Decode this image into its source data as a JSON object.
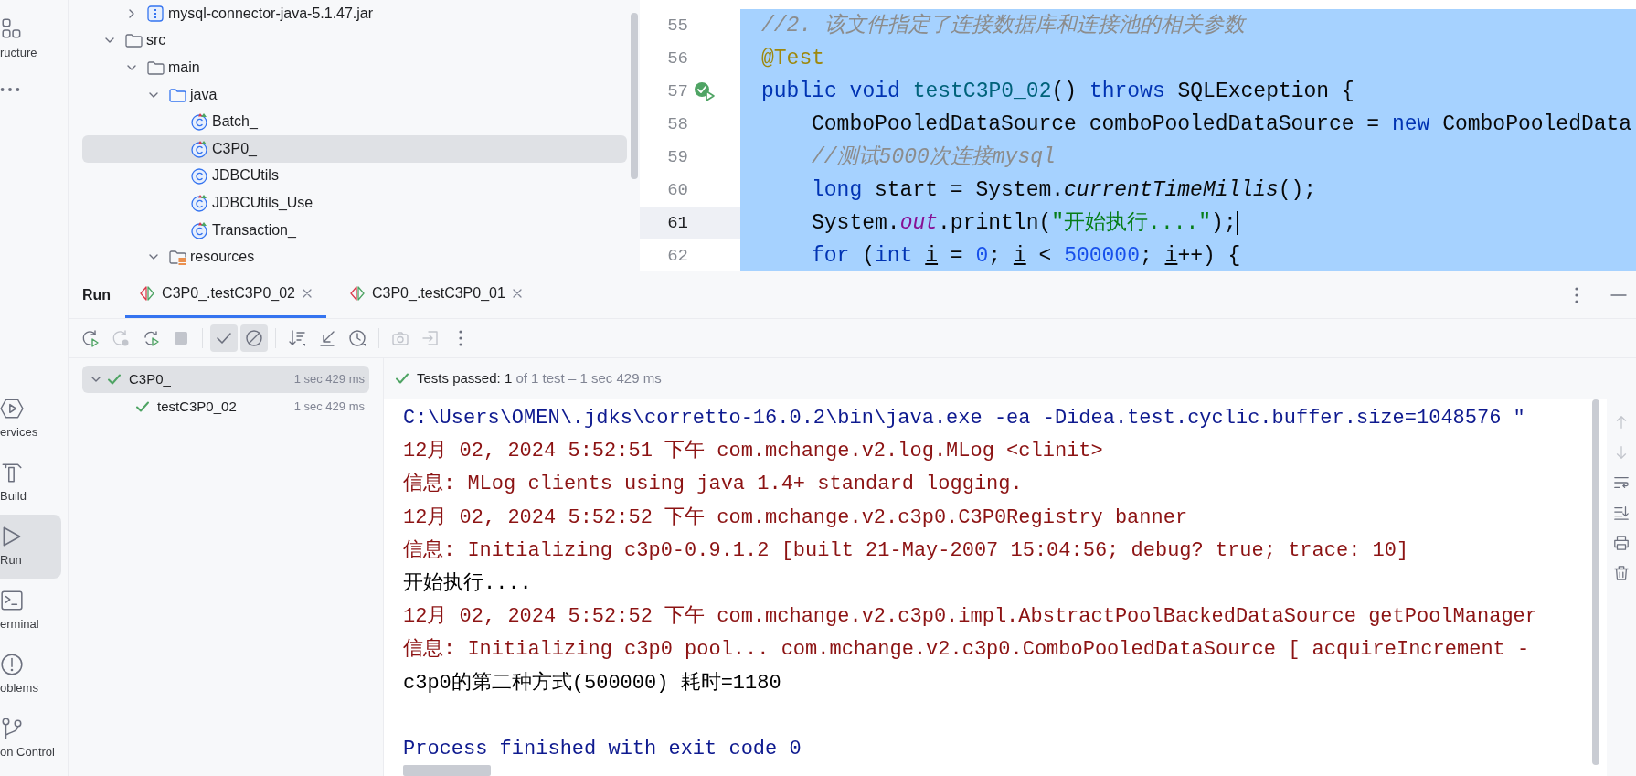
{
  "tool_strip": [
    {
      "kind": "structure",
      "label": "ructure",
      "selected": false
    },
    {
      "kind": "more",
      "selected": false
    },
    {
      "kind": "services",
      "label": "ervices",
      "selected": false
    },
    {
      "kind": "build",
      "label": "Build",
      "selected": false
    },
    {
      "kind": "run",
      "label": "Run",
      "selected": true
    },
    {
      "kind": "terminal",
      "label": "erminal",
      "selected": false
    },
    {
      "kind": "problems",
      "label": "oblems",
      "selected": false
    },
    {
      "kind": "vcs",
      "label": "on Control",
      "selected": false
    }
  ],
  "project_tree": {
    "partial_parent_children": [
      {
        "label": "mysql-connector-java-5.1.47.jar",
        "kind": "jar",
        "expanded": false,
        "selected": false
      }
    ],
    "items": [
      {
        "label": "src",
        "kind": "folder",
        "expanded": true,
        "selected": false,
        "children": [
          {
            "label": "main",
            "kind": "folder",
            "expanded": true,
            "selected": false,
            "children": [
              {
                "label": "java",
                "kind": "source_root",
                "expanded": true,
                "selected": false,
                "children": [
                  {
                    "label": "Batch_",
                    "kind": "test_class",
                    "selected": false
                  },
                  {
                    "label": "C3P0_",
                    "kind": "test_class",
                    "selected": true
                  },
                  {
                    "label": "JDBCUtils",
                    "kind": "class",
                    "selected": false
                  },
                  {
                    "label": "JDBCUtils_Use",
                    "kind": "test_class",
                    "selected": false
                  },
                  {
                    "label": "Transaction_",
                    "kind": "test_class",
                    "selected": false
                  }
                ]
              },
              {
                "label": "resources",
                "kind": "resources_root",
                "expanded": true,
                "selected": false
              }
            ]
          }
        ]
      }
    ]
  },
  "editor": {
    "lines": [
      {
        "number": "55",
        "current": false,
        "selected": true,
        "tokens": [
          {
            "kind": "comment",
            "text": "//2. 该文件指定了连接数据库和连接池的相关参数"
          }
        ]
      },
      {
        "number": "56",
        "current": false,
        "selected": true,
        "tokens": [
          {
            "kind": "annotation",
            "text": "@Test"
          }
        ]
      },
      {
        "number": "57",
        "current": false,
        "selected": true,
        "run_marker": true,
        "tokens": [
          {
            "kind": "keyword",
            "text": "public void "
          },
          {
            "kind": "declaration",
            "text": "testC3P0_02"
          },
          {
            "kind": "plain",
            "text": "() "
          },
          {
            "kind": "keyword",
            "text": "throws "
          },
          {
            "kind": "plain",
            "text": "SQLException {"
          }
        ],
        "children": [
          {
            "number": "58",
            "current": false,
            "selected": true,
            "tokens": [
              {
                "kind": "plain",
                "text": "ComboPooledDataSource comboPooledDataSource = "
              },
              {
                "kind": "keyword",
                "text": "new "
              },
              {
                "kind": "plain",
                "text": "ComboPooledData"
              }
            ]
          },
          {
            "number": "59",
            "current": false,
            "selected": true,
            "tokens": [
              {
                "kind": "comment",
                "text": "//测试5000次连接mysql"
              }
            ]
          },
          {
            "number": "60",
            "current": false,
            "selected": true,
            "tokens": [
              {
                "kind": "keyword",
                "text": "long "
              },
              {
                "kind": "plain",
                "text": "start = System."
              },
              {
                "kind": "static",
                "text": "currentTimeMillis"
              },
              {
                "kind": "plain",
                "text": "();"
              }
            ]
          },
          {
            "number": "61",
            "current": true,
            "selected": true,
            "tokens": [
              {
                "kind": "plain",
                "text": "System."
              },
              {
                "kind": "field",
                "text": "out"
              },
              {
                "kind": "plain",
                "text": ".println("
              },
              {
                "kind": "string",
                "text": "\"开始执行....\""
              },
              {
                "kind": "plain",
                "text": ");"
              }
            ]
          },
          {
            "number": "62",
            "current": false,
            "selected": true,
            "tokens": [
              {
                "kind": "keyword",
                "text": "for "
              },
              {
                "kind": "plain",
                "text": "("
              },
              {
                "kind": "keyword",
                "text": "int "
              },
              {
                "kind": "variable",
                "text": "i"
              },
              {
                "kind": "plain",
                "text": " = "
              },
              {
                "kind": "number",
                "text": "0"
              },
              {
                "kind": "plain",
                "text": "; "
              },
              {
                "kind": "variable",
                "text": "i"
              },
              {
                "kind": "plain",
                "text": " < "
              },
              {
                "kind": "number",
                "text": "500000"
              },
              {
                "kind": "plain",
                "text": "; "
              },
              {
                "kind": "variable",
                "text": "i"
              },
              {
                "kind": "plain",
                "text": "++) {"
              }
            ]
          }
        ]
      }
    ]
  },
  "run_panel": {
    "title": "Run",
    "tabs": [
      {
        "label": "C3P0_.testC3P0_02",
        "selected": true
      },
      {
        "label": "C3P0_.testC3P0_01",
        "selected": false
      }
    ],
    "toolbar": [
      {
        "disabled": false,
        "toggled": false
      },
      {
        "disabled": true,
        "toggled": false
      },
      {
        "disabled": false,
        "toggled": false
      },
      {
        "disabled": true,
        "toggled": false
      },
      {
        "disabled": false,
        "toggled": true
      },
      {
        "disabled": false,
        "toggled": true
      },
      {
        "disabled": false,
        "toggled": false
      },
      {
        "disabled": false,
        "toggled": false
      },
      {
        "disabled": false,
        "toggled": false
      },
      {
        "disabled": true,
        "toggled": false
      },
      {
        "disabled": true,
        "toggled": false
      },
      {
        "disabled": false,
        "toggled": false
      }
    ],
    "test_tree": [
      {
        "label": "C3P0_",
        "time": "1 sec 429 ms",
        "passed": true,
        "expanded": true,
        "selected": true,
        "children": [
          {
            "label": "testC3P0_02",
            "time": "1 sec 429 ms",
            "passed": true,
            "selected": false
          }
        ]
      }
    ],
    "status": {
      "summary": "Tests passed: 1",
      "detail": "of 1 test – 1 sec 429 ms"
    },
    "console": [
      {
        "kind": "command",
        "text": "C:\\Users\\OMEN\\.jdks\\corretto-16.0.2\\bin\\java.exe -ea -Didea.test.cyclic.buffer.size=1048576 \""
      },
      {
        "kind": "stderr",
        "text": "12月 02, 2024 5:52:51 下午 com.mchange.v2.log.MLog <clinit>"
      },
      {
        "kind": "stderr",
        "text": "信息: MLog clients using java 1.4+ standard logging."
      },
      {
        "kind": "stderr",
        "text": "12月 02, 2024 5:52:52 下午 com.mchange.v2.c3p0.C3P0Registry banner"
      },
      {
        "kind": "stderr",
        "text": "信息: Initializing c3p0-0.9.1.2 [built 21-May-2007 15:04:56; debug? true; trace: 10]"
      },
      {
        "kind": "stdout",
        "text": "开始执行...."
      },
      {
        "kind": "stderr",
        "text": "12月 02, 2024 5:52:52 下午 com.mchange.v2.c3p0.impl.AbstractPoolBackedDataSource getPoolManager"
      },
      {
        "kind": "stderr",
        "text": "信息: Initializing c3p0 pool... com.mchange.v2.c3p0.ComboPooledDataSource [ acquireIncrement -"
      },
      {
        "kind": "stdout",
        "text": "c3p0的第二种方式(500000) 耗时=1180"
      },
      {
        "kind": "blank"
      },
      {
        "kind": "system",
        "text": "Process finished with exit code 0"
      }
    ],
    "console_actions": [
      {
        "disabled": true
      },
      {
        "disabled": true
      },
      {
        "disabled": false
      },
      {
        "disabled": false
      },
      {
        "disabled": false
      },
      {
        "disabled": false
      }
    ]
  }
}
